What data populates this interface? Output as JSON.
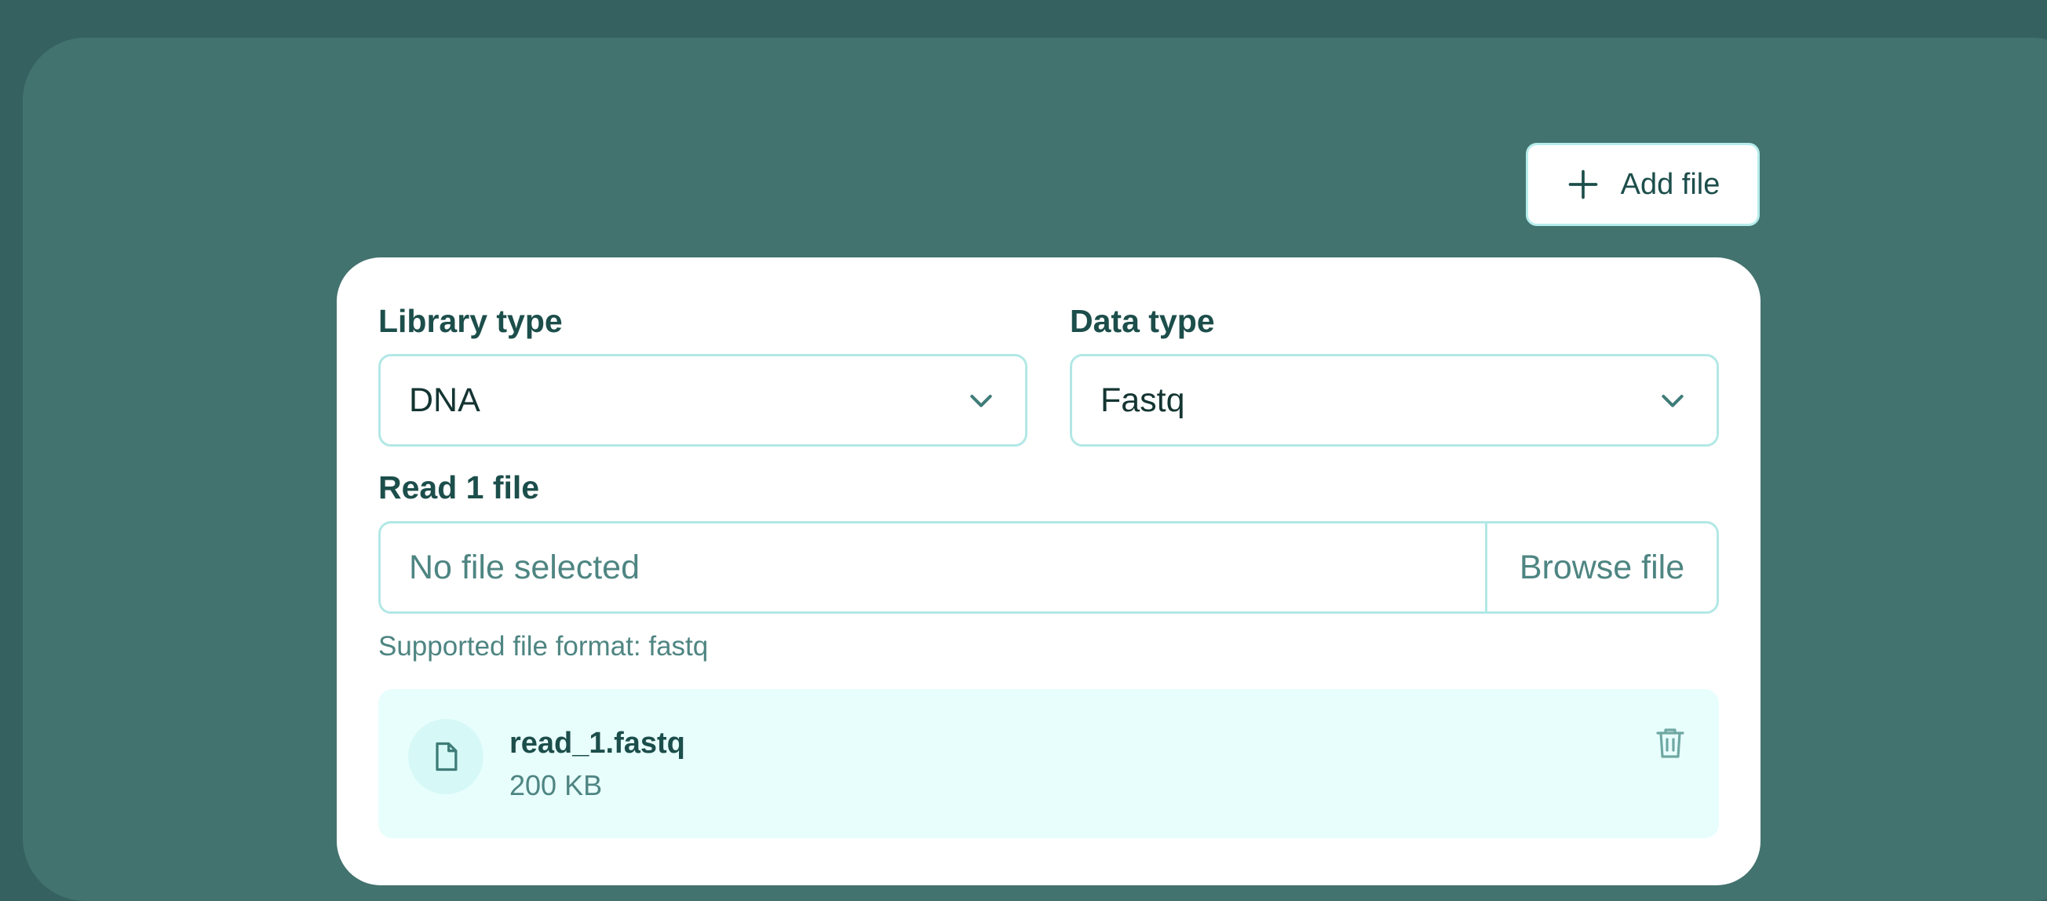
{
  "toolbar": {
    "add_file_label": "Add file",
    "add_icon": "plus-icon"
  },
  "form": {
    "library_type": {
      "label": "Library type",
      "value": "DNA"
    },
    "data_type": {
      "label": "Data type",
      "value": "Fastq"
    },
    "read1": {
      "label": "Read 1 file",
      "placeholder": "No file selected",
      "browse_label": "Browse file",
      "hint": "Supported file format: fastq"
    }
  },
  "uploaded_file": {
    "name": "read_1.fastq",
    "size": "200 KB",
    "icon": "file-icon",
    "delete_icon": "trash-icon"
  },
  "colors": {
    "background": "#356260",
    "panel": "#43736f",
    "accent_border": "#b2e8e6",
    "text_dark": "#1c4e4b",
    "text_muted": "#4e8582",
    "file_item_bg": "#e8fefd"
  }
}
